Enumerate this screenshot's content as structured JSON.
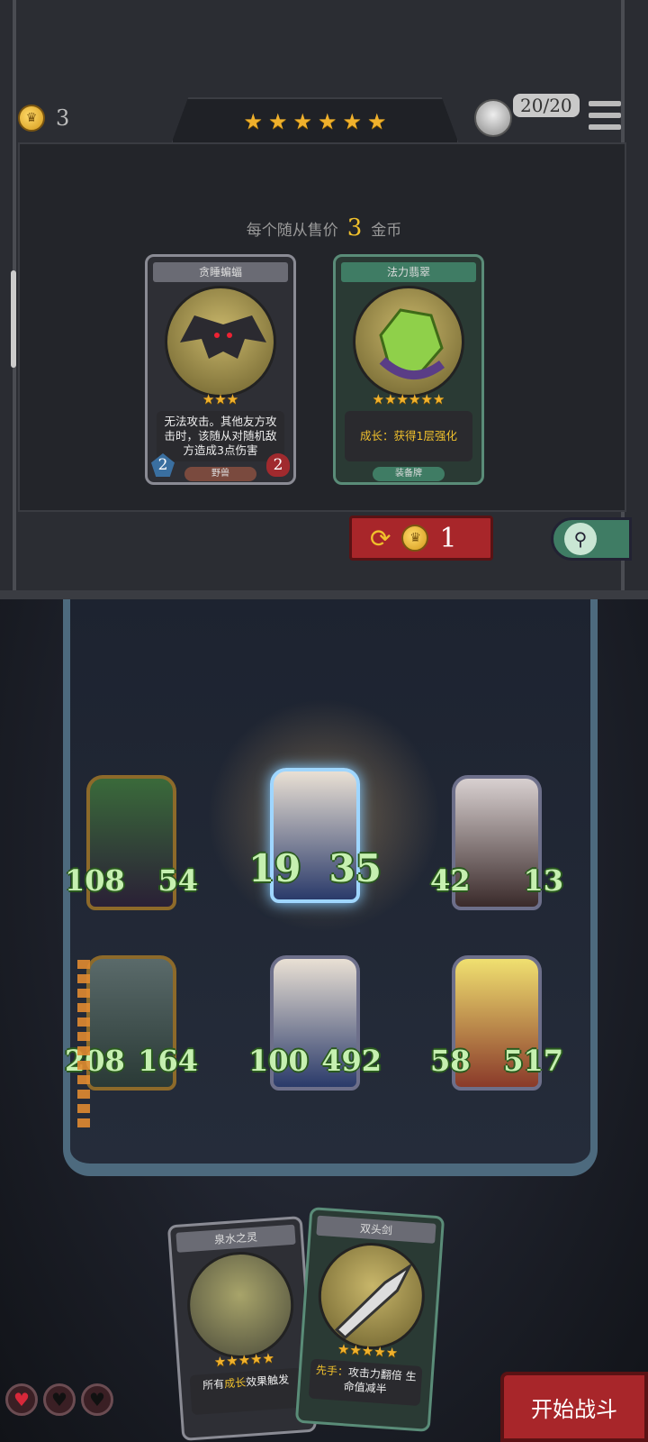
{
  "shop": {
    "gold": "3",
    "tier_stars": 6,
    "player_count": "20/20",
    "price_text_before": "每个随从售价",
    "price_value": "3",
    "price_text_after": "金币",
    "cards": [
      {
        "title": "贪睡蝙蝠",
        "stars": 3,
        "desc": "无法攻击。其他友方攻击时，该随从对随机敌方造成3点伤害",
        "type": "野兽",
        "attack": "2",
        "health": "2"
      },
      {
        "title": "法力翡翠",
        "stars": 6,
        "desc_prefix": "成长：获得1层",
        "desc_highlight": "强化",
        "type": "装备牌"
      }
    ],
    "refresh_cost": "1"
  },
  "board": {
    "units": [
      {
        "name": "green-hair-sorceress",
        "attack": "108",
        "health": "54"
      },
      {
        "name": "voodoo-rabbit",
        "attack": "19",
        "health": "35"
      },
      {
        "name": "masked-rat",
        "attack": "42",
        "health": "13"
      },
      {
        "name": "iron-golem",
        "attack": "208",
        "health": "164"
      },
      {
        "name": "voodoo-rabbit-2",
        "attack": "100",
        "health": "492"
      },
      {
        "name": "dwarf-warrior",
        "attack": "58",
        "health": "517"
      }
    ]
  },
  "hand": [
    {
      "title": "泉水之灵",
      "stars": 5,
      "desc_prefix": "所有",
      "desc_highlight": "成长",
      "desc_suffix": "效果触发"
    },
    {
      "title": "双头剑",
      "stars": 5,
      "desc_highlight": "先手：",
      "desc_suffix": "攻击力翻倍 生命值减半"
    }
  ],
  "lives": {
    "full": 1,
    "total": 3
  },
  "start_button": "开始战斗",
  "colors": {
    "gold": "#f0c02c",
    "red_button": "#a8262a",
    "green_accent": "#3f7c64",
    "stat_green": "#c6f0b0"
  }
}
